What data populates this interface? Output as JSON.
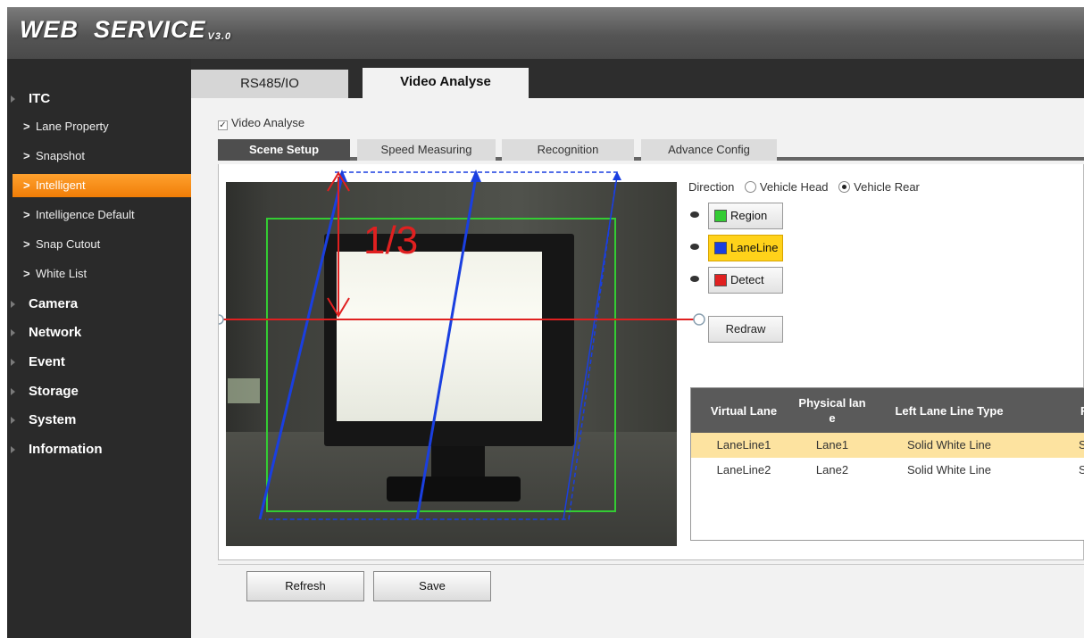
{
  "header": {
    "logo_text": "WEB  SERVICE",
    "version": "V3.0"
  },
  "sidebar": {
    "sections": [
      {
        "label": "ITC"
      },
      {
        "label": "Camera"
      },
      {
        "label": "Network"
      },
      {
        "label": "Event"
      },
      {
        "label": "Storage"
      },
      {
        "label": "System"
      },
      {
        "label": "Information"
      }
    ],
    "itc_items": [
      {
        "label": "Lane Property"
      },
      {
        "label": "Snapshot"
      },
      {
        "label": "Intelligent",
        "active": true
      },
      {
        "label": "Intelligence Default"
      },
      {
        "label": "Snap Cutout"
      },
      {
        "label": "White List"
      }
    ]
  },
  "tabs": [
    {
      "label": "RS485/IO",
      "active": false
    },
    {
      "label": "Video Analyse",
      "active": true
    }
  ],
  "video_analyse_checkbox": {
    "label": "Video Analyse",
    "checked": true,
    "mark": "✓"
  },
  "sub_tabs": [
    {
      "label": "Scene Setup",
      "active": true
    },
    {
      "label": "Speed Measuring",
      "active": false
    },
    {
      "label": "Recognition",
      "active": false
    },
    {
      "label": "Advance Config",
      "active": false
    }
  ],
  "video": {
    "annotation": "1/3"
  },
  "direction": {
    "label": "Direction",
    "options": [
      {
        "label": "Vehicle Head",
        "checked": false
      },
      {
        "label": "Vehicle Rear",
        "checked": true
      }
    ]
  },
  "draw_buttons": [
    {
      "label": "Region",
      "color": "#33cc33",
      "selected": false
    },
    {
      "label": "LaneLine",
      "color": "#1a3fe0",
      "selected": true
    },
    {
      "label": "Detect",
      "color": "#e02020",
      "selected": false
    }
  ],
  "redraw_label": "Redraw",
  "lane_table": {
    "headers": [
      "Virtual Lane",
      "Physical lan\ne",
      "Left Lane Line Type",
      "R"
    ],
    "rows": [
      {
        "cells": [
          "LaneLine1",
          "Lane1",
          "Solid White Line",
          "S"
        ],
        "selected": true
      },
      {
        "cells": [
          "LaneLine2",
          "Lane2",
          "Solid White Line",
          "S"
        ],
        "selected": false
      }
    ]
  },
  "actions": {
    "refresh_label": "Refresh",
    "save_label": "Save"
  },
  "colors": {
    "accent_orange": "#f07d07",
    "region_green": "#33cc33",
    "laneline_blue": "#1a3fe0",
    "detect_red": "#e02020",
    "selected_row": "#fde3a0"
  }
}
